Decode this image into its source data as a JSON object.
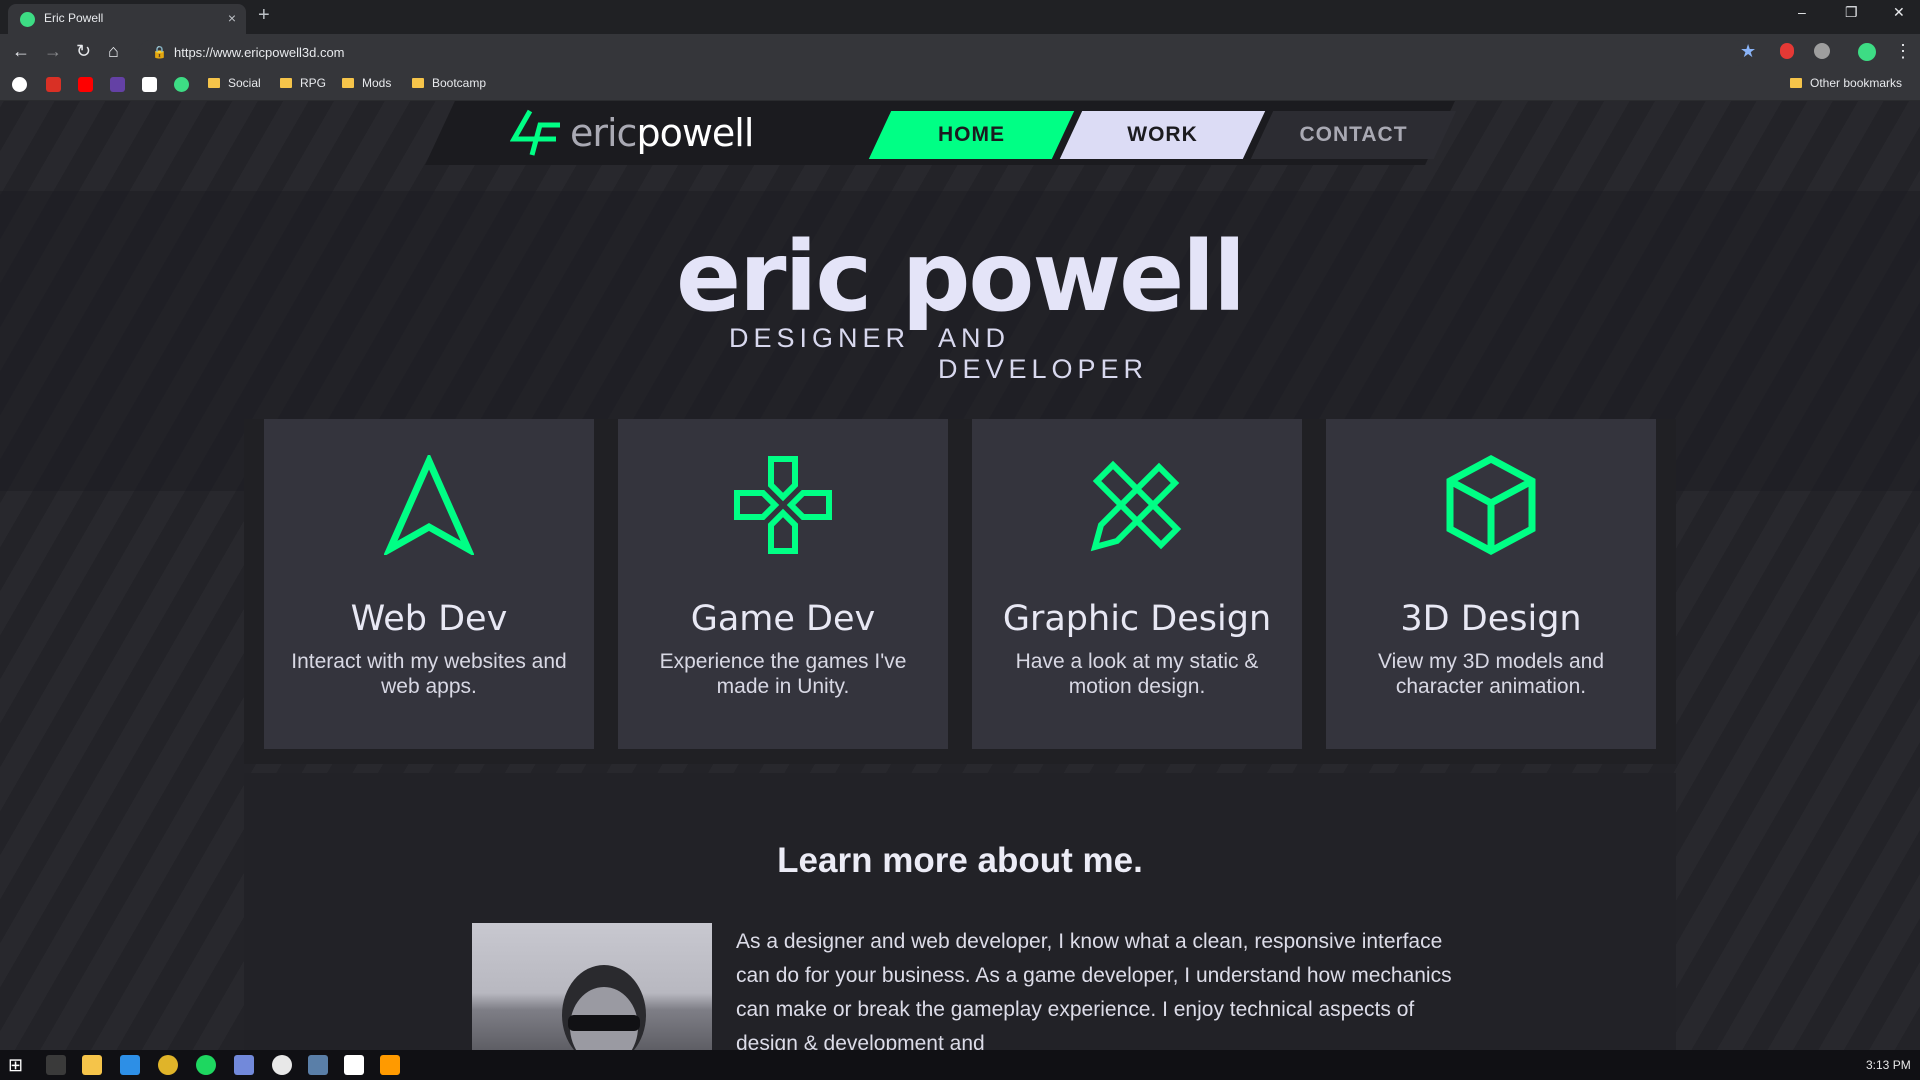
{
  "browser": {
    "tab_title": "Eric Powell",
    "tab_close": "×",
    "new_tab": "+",
    "url": "https://www.ericpowell3d.com",
    "bookmarks": [
      "Social",
      "RPG",
      "Mods",
      "Bootcamp"
    ],
    "other_bookmarks": "Other bookmarks"
  },
  "site": {
    "logo_eric": "eric",
    "logo_powell": "powell",
    "nav": {
      "home": "HOME",
      "work": "WORK",
      "contact": "CONTACT"
    },
    "hero": {
      "name": "eric powell",
      "sub_left": "DESIGNER",
      "sub_right": "AND DEVELOPER"
    },
    "cards": [
      {
        "icon": "arrow-navigation-icon",
        "title": "Web Dev",
        "text": "Interact with my websites and web apps."
      },
      {
        "icon": "gamepad-cross-icon",
        "title": "Game Dev",
        "text": "Experience the games I've made in Unity."
      },
      {
        "icon": "pencil-ruler-icon",
        "title": "Graphic Design",
        "text": "Have a look at my static & motion design."
      },
      {
        "icon": "cube-icon",
        "title": "3D Design",
        "text": "View my 3D models and character animation."
      }
    ],
    "about": {
      "title": "Learn more about me.",
      "text": "As a designer and web developer, I know what a clean, responsive interface can do for your business. As a game developer, I understand how mechanics can make or break the gameplay experience. I enjoy technical aspects of design & development and"
    }
  },
  "taskbar": {
    "clock": "3:13 PM"
  },
  "colors": {
    "accent": "#00ff85",
    "nav_work": "#dcdcf5",
    "card_bg": "#34343d",
    "page_bg": "#232328"
  }
}
